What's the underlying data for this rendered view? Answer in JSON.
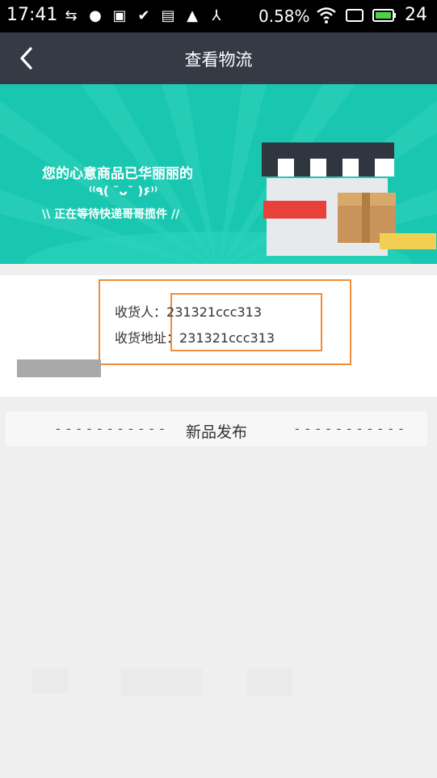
{
  "status_bar": {
    "time": "17:41",
    "battery_percent_text": "0.58%",
    "battery_level": "24",
    "icons": [
      "usb-icon",
      "chat-icon",
      "image-icon",
      "check-icon",
      "doc-icon",
      "warning-icon",
      "network-icon"
    ]
  },
  "app_bar": {
    "title": "查看物流"
  },
  "banner": {
    "line1": "您的心意商品已华丽丽的",
    "line2": "⁽⁽٩( ˘ᴗ˘ )۶⁾⁾",
    "line3": "\\\\ 正在等待快递哥哥揽件 //"
  },
  "shipment": {
    "receiver_label": "收货人：",
    "receiver_value": "231321ccc313",
    "address_label": "收货地址：",
    "address_value": "231321ccc313"
  },
  "section": {
    "dashes": "- - - - - - - - - - -",
    "title": "新品发布"
  },
  "colors": {
    "app_bar": "#343b45",
    "banner": "#19c7b0",
    "highlight": "#f08c3a",
    "status_bar": "#000000"
  }
}
